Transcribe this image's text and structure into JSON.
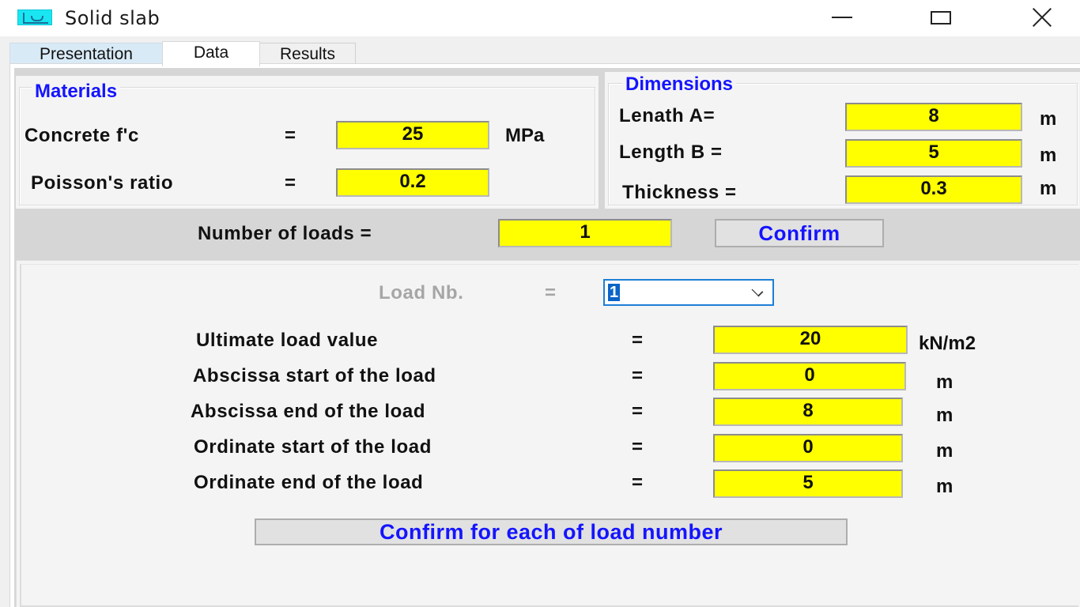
{
  "window": {
    "title": "Solid slab",
    "icon": "app-icon",
    "controls": {
      "minimize": "minimize-icon",
      "maximize": "maximize-icon",
      "close": "close-icon"
    }
  },
  "tabs": [
    {
      "label": "Presentation",
      "active": false
    },
    {
      "label": "Data",
      "active": true
    },
    {
      "label": "Results",
      "active": false
    }
  ],
  "materials": {
    "legend": "Materials",
    "concrete": {
      "label": "Concrete  f'c",
      "eq": "=",
      "value": "25",
      "unit": "MPa"
    },
    "poisson": {
      "label": "Poisson's ratio",
      "eq": "=",
      "value": "0.2"
    }
  },
  "dimensions": {
    "legend": "Dimensions",
    "length_a": {
      "label": "Lenath A=",
      "value": "8",
      "unit": "m"
    },
    "length_b": {
      "label": "Length B =",
      "value": "5",
      "unit": "m"
    },
    "thickness": {
      "label": "Thickness =",
      "value": "0.3",
      "unit": "m"
    }
  },
  "loads": {
    "label": "Number of loads =",
    "value": "1",
    "confirm_label": "Confirm"
  },
  "load_detail": {
    "load_nb": {
      "label": "Load Nb.",
      "eq": "=",
      "selected": "1"
    },
    "rows": [
      {
        "label": "Ultimate load value",
        "eq": "=",
        "value": "20",
        "unit": "kN/m2"
      },
      {
        "label": "Abscissa start of the load",
        "eq": "=",
        "value": "0",
        "unit": "m"
      },
      {
        "label": "Abscissa end of the load",
        "eq": "=",
        "value": "8",
        "unit": "m"
      },
      {
        "label": "Ordinate start of the load",
        "eq": "=",
        "value": "0",
        "unit": "m"
      },
      {
        "label": "Ordinate end of the load",
        "eq": "=",
        "value": "5",
        "unit": "m"
      }
    ],
    "confirm_each_label": "Confirm for each of load number"
  },
  "colors": {
    "field_bg": "#ffff00",
    "legend_text": "#1414ff",
    "button_text": "#1414ff",
    "focus_border": "#1e7fd8"
  }
}
